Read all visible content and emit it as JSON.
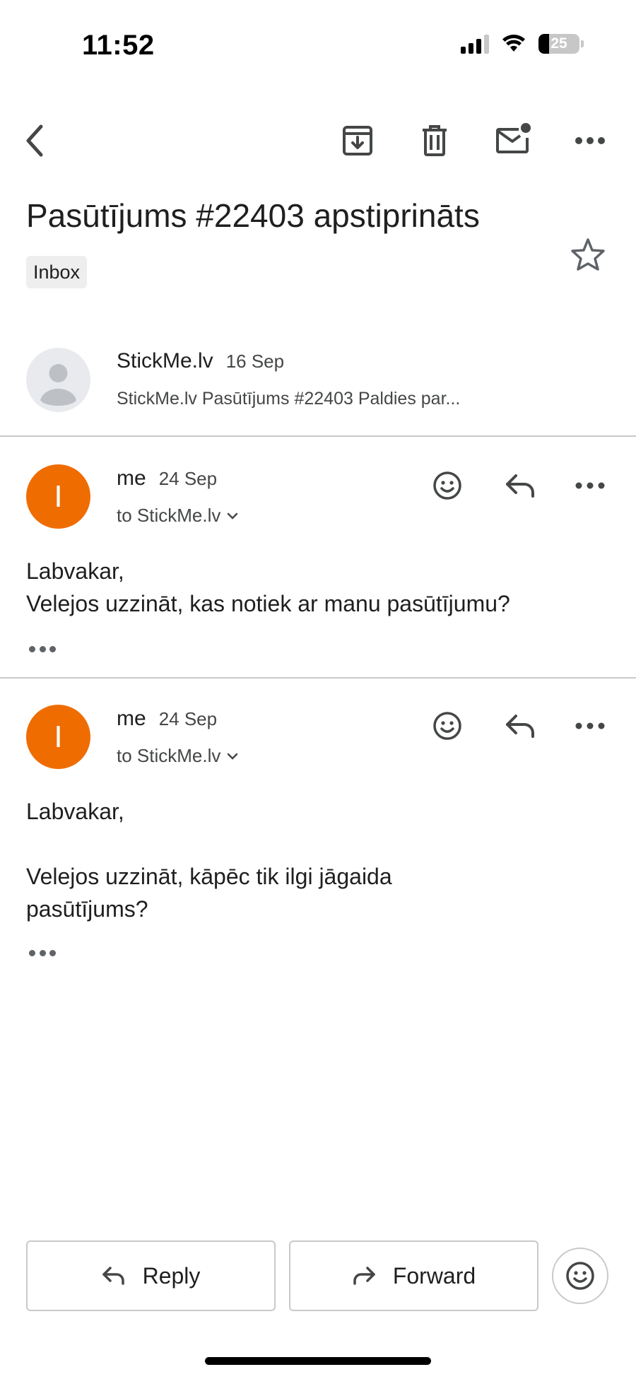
{
  "status_bar": {
    "time": "11:52",
    "battery_level": "25",
    "battery_fraction": 0.25,
    "icons": [
      "signal-icon",
      "wifi-icon",
      "battery-icon"
    ]
  },
  "toolbar": {
    "icons": [
      "back-arrow-icon",
      "archive-icon",
      "delete-icon",
      "mark-unread-icon",
      "more-icon"
    ]
  },
  "email": {
    "subject": "Pasūtījums #22403 apstiprināts",
    "label": "Inbox",
    "starred": false
  },
  "thread": {
    "collapsed": {
      "sender": "StickMe.lv",
      "date": "16 Sep",
      "snippet": "StickMe.lv Pasūtījums #22403 Paldies par..."
    },
    "messages": [
      {
        "avatar_letter": "I",
        "sender": "me",
        "date": "24 Sep",
        "recipient": "to StickMe.lv",
        "body_lines": [
          "Labvakar,",
          "Velejos uzzināt, kas notiek ar manu pasūtījumu?"
        ]
      },
      {
        "avatar_letter": "I",
        "sender": "me",
        "date": "24 Sep",
        "recipient": "to StickMe.lv",
        "body_lines": [
          "Labvakar,",
          "",
          "Velejos uzzināt, kāpēc tik ilgi jāgaida",
          "pasūtījums?"
        ]
      }
    ]
  },
  "actions": {
    "reply_label": "Reply",
    "forward_label": "Forward"
  },
  "colors": {
    "avatar_accent": "#ef6c00",
    "divider": "#c9c9c9",
    "chip_bg": "#eeeeee"
  }
}
